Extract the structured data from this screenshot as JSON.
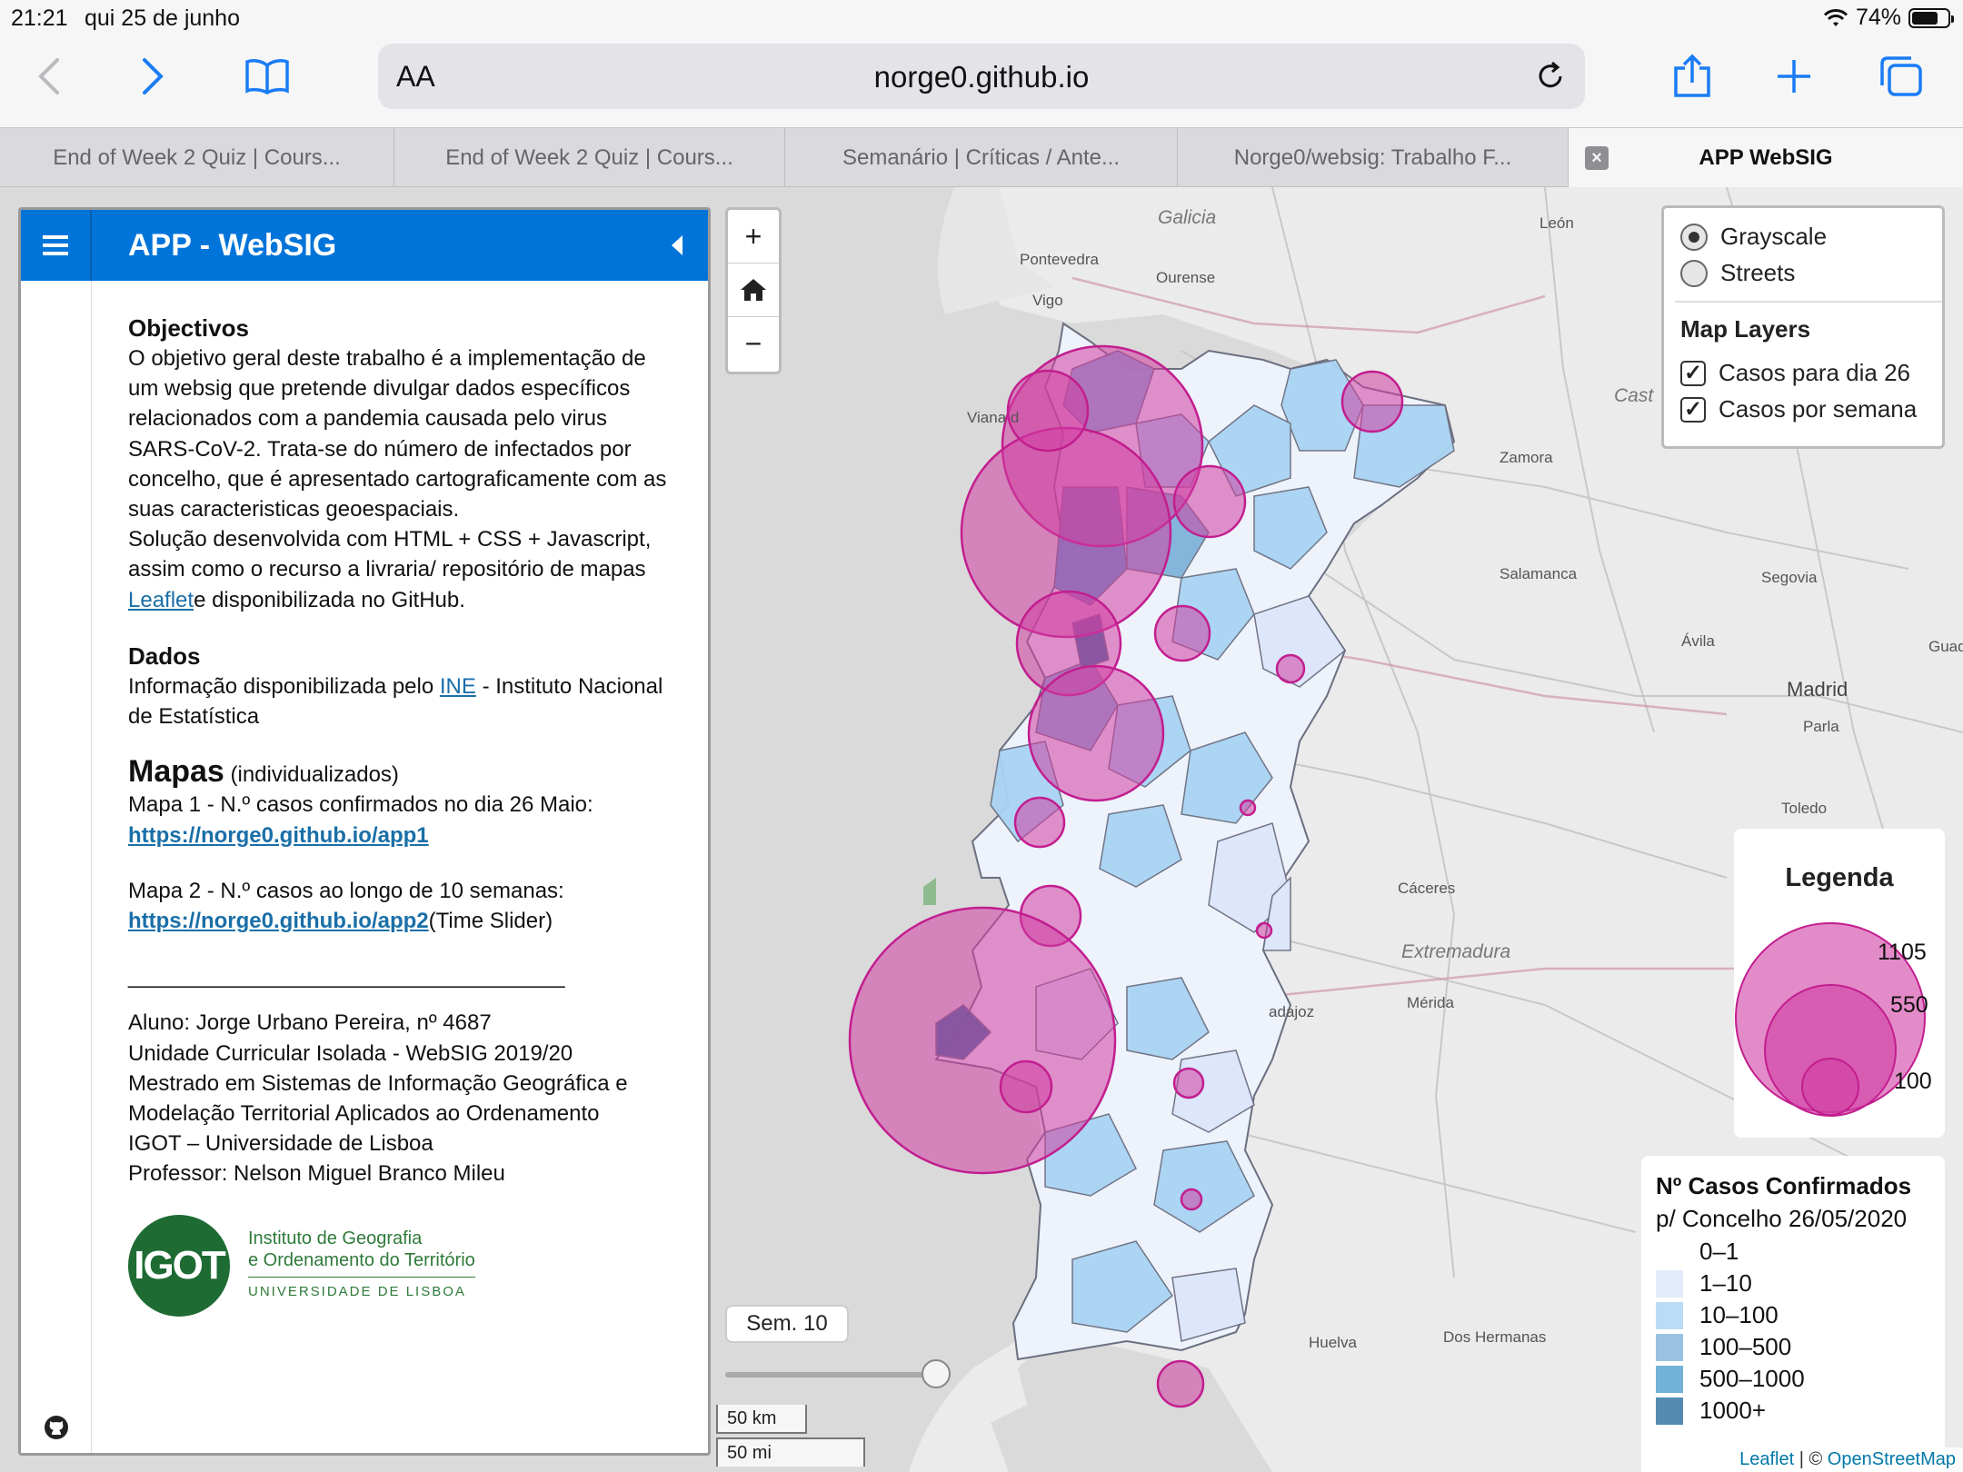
{
  "status": {
    "time": "21:21",
    "date": "qui 25 de junho",
    "battery": "74%",
    "battery_level": 0.74
  },
  "browser": {
    "aa": "AA",
    "url": "norge0.github.io",
    "icons": [
      "back-icon",
      "forward-icon",
      "bookmarks-icon",
      "reload-icon",
      "share-icon",
      "new-tab-icon",
      "tabs-icon"
    ]
  },
  "tabs": [
    {
      "label": "End of Week 2 Quiz | Cours..."
    },
    {
      "label": "End of Week 2 Quiz | Cours..."
    },
    {
      "label": "Semanário | Críticas / Ante..."
    },
    {
      "label": "Norge0/websig: Trabalho F..."
    },
    {
      "label": "APP WebSIG",
      "active": true
    }
  ],
  "sidebar": {
    "title": "APP - WebSIG",
    "objectivos_title": "Objectivos",
    "objectivos_text": "O objetivo geral deste trabalho é a implementação de um websig que pretende divulgar dados específicos relacionados com a pandemia causada pelo virus SARS-CoV-2. Trata-se do número de infectados por concelho, que é apresentado cartograficamente com as suas caracteristicas geoespaciais.",
    "solucao_pre": "Solução desenvolvida com HTML + CSS + Javascript, assim como o recurso a livraria/ repositório de mapas ",
    "solucao_link": "Leaflet",
    "solucao_post": "e disponibilizada no GitHub.",
    "dados_title": "Dados",
    "dados_pre": "Informação disponibilizada pelo ",
    "dados_link": "INE",
    "dados_post": " - Instituto Nacional de Estatística",
    "mapas_title": "Mapas",
    "mapas_sub": " (individualizados)",
    "mapa1_text": "Mapa 1 - N.º casos confirmados no dia 26 Maio:",
    "mapa1_link": "https://norge0.github.io/app1",
    "mapa2_text": "Mapa 2 - N.º casos ao longo de 10 semanas:",
    "mapa2_link": "https://norge0.github.io/app2",
    "mapa2_post": "(Time Slider)",
    "separator": "____________________________________",
    "credits": [
      "Aluno: Jorge Urbano Pereira, nº 4687",
      "Unidade Curricular Isolada - WebSIG 2019/20",
      "Mestrado em Sistemas de Informação Geográfica e Modelação Territorial Aplicados ao Ordenamento",
      "IGOT – Universidade de Lisboa",
      "Professor: Nelson Miguel Branco Mileu"
    ],
    "logo_text": "IGOT",
    "logo_line1": "Instituto de Geografia",
    "logo_line2": "e Ordenamento do Território",
    "logo_line3": "UNIVERSIDADE DE LISBOA"
  },
  "map": {
    "zoom_in": "+",
    "zoom_out": "−",
    "basemaps": [
      {
        "label": "Grayscale",
        "selected": true
      },
      {
        "label": "Streets",
        "selected": false
      }
    ],
    "layers_title": "Map Layers",
    "layers": [
      {
        "label": "Casos para dia 26",
        "checked": true
      },
      {
        "label": "Casos por semana",
        "checked": true
      }
    ],
    "legend_title": "Legenda",
    "legend_values": [
      "1105",
      "550",
      "100"
    ],
    "choro_title": "Nº Casos Confirmados",
    "choro_subtitle": "p/ Concelho 26/05/2020",
    "choro_classes": [
      {
        "label": "0–1",
        "color": "#ffffff"
      },
      {
        "label": "1–10",
        "color": "#dde6fb"
      },
      {
        "label": "10–100",
        "color": "#a9d3f3"
      },
      {
        "label": "100–500",
        "color": "#7fb3da"
      },
      {
        "label": "500–1000",
        "color": "#4f9fcf"
      },
      {
        "label": "1000+",
        "color": "#2a6e9c"
      }
    ],
    "slider_label": "Sem. 10",
    "scale_km": "50 km",
    "scale_mi": "50 mi",
    "attribution_leaflet": "Leaflet",
    "attribution_sep": " | © ",
    "attribution_osm": "OpenStreetMap",
    "place_labels": [
      "Galicia",
      "Pontevedra",
      "Ourense",
      "León",
      "Vigo",
      "Viana d",
      "Zamora",
      "Salamanca",
      "Segovia",
      "Ávila",
      "Madrid",
      "Parla",
      "Toledo",
      "Cáceres",
      "Extremadura",
      "Mérida",
      "adajoz",
      "Huelva",
      "Dos Hermanas",
      "Guadala",
      "Cast"
    ]
  }
}
